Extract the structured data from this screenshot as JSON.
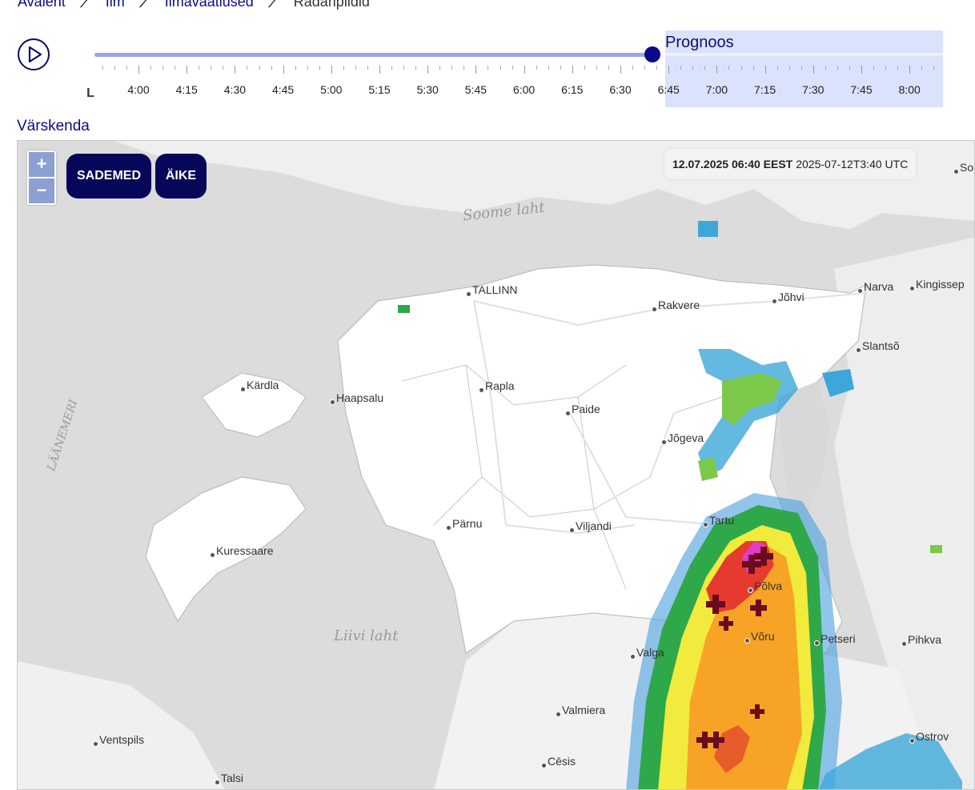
{
  "breadcrumb": [
    {
      "label": "Avaleht"
    },
    {
      "label": "Ilm"
    },
    {
      "label": "Ilmavaatlused"
    },
    {
      "label": "Radaripildid"
    }
  ],
  "timeline": {
    "start_label": "L",
    "forecast_label": "Prognoos",
    "times": [
      "4:00",
      "4:15",
      "4:30",
      "4:45",
      "5:00",
      "5:15",
      "5:30",
      "5:45",
      "6:00",
      "6:15",
      "6:30",
      "6:45",
      "7:00",
      "7:15",
      "7:30",
      "7:45",
      "8:00"
    ],
    "current_time": "6:40"
  },
  "refresh_label": "Värskenda",
  "map": {
    "zoom_in": "+",
    "zoom_out": "−",
    "layers": [
      "SADEMED",
      "ÄIKE"
    ],
    "timestamp_local": "12.07.2025 06:40 EEST",
    "timestamp_utc": "2025-07-12T3:40 UTC",
    "sea_labels": [
      "Soome laht",
      "LÄÄNEMERI",
      "Liivi laht"
    ],
    "places": [
      "TALLINN",
      "Rakvere",
      "Jõhvi",
      "Narva",
      "Kingissep",
      "Slantsõ",
      "Kärdla",
      "Haapsalu",
      "Rapla",
      "Paide",
      "Jõgeva",
      "Tartu",
      "Põlva",
      "Võru",
      "Petseri",
      "Pihkva",
      "Valga",
      "Pärnu",
      "Viljandi",
      "Kuressaare",
      "Valmiera",
      "Cēsis",
      "Ventspils",
      "Talsi",
      "Ostrov",
      "So"
    ]
  }
}
